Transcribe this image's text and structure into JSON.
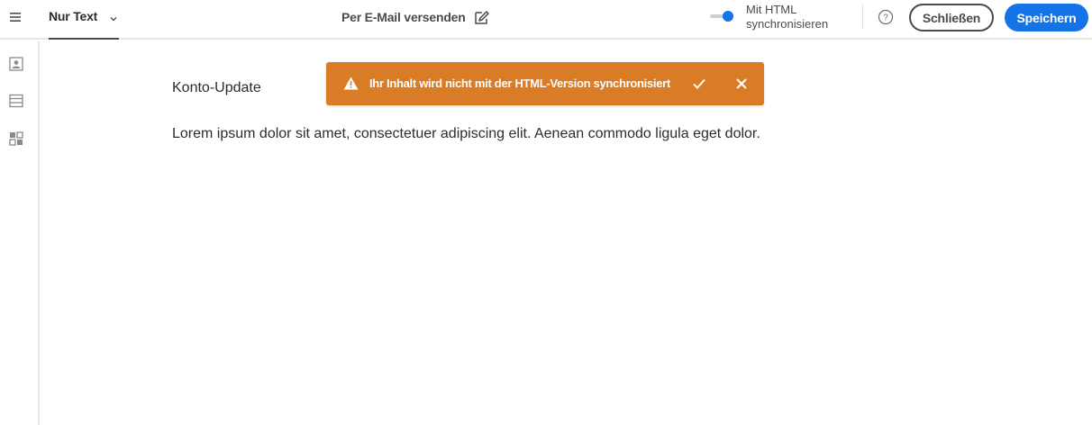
{
  "header": {
    "menu_icon": "hamburger-icon",
    "view_tab": {
      "label": "Nur Text",
      "icon": "chevron-down-icon"
    },
    "send_email": {
      "label": "Per E-Mail versenden",
      "icon": "edit-icon"
    },
    "sync": {
      "label": "Mit HTML synchronisieren",
      "enabled": true
    },
    "help_icon": "help-icon",
    "close_label": "Schließen",
    "save_label": "Speichern"
  },
  "sidebar": {
    "items": [
      {
        "name": "personalization",
        "icon": "contact-card-icon"
      },
      {
        "name": "structure",
        "icon": "layout-icon"
      },
      {
        "name": "fragments",
        "icon": "fragments-icon"
      }
    ]
  },
  "content": {
    "subject": "Konto-Update",
    "body": "Lorem ipsum dolor sit amet, consectetuer adipiscing elit. Aenean commodo ligula eget dolor."
  },
  "toast": {
    "icon": "warning-icon",
    "message": "Ihr Inhalt wird nicht mit der HTML-Version synchronisiert",
    "accept_icon": "checkmark-icon",
    "dismiss_icon": "close-icon"
  },
  "colors": {
    "accent": "#1473e6",
    "warning": "#da7b25",
    "text": "#2c2c2c",
    "muted": "#4b4b4b"
  }
}
